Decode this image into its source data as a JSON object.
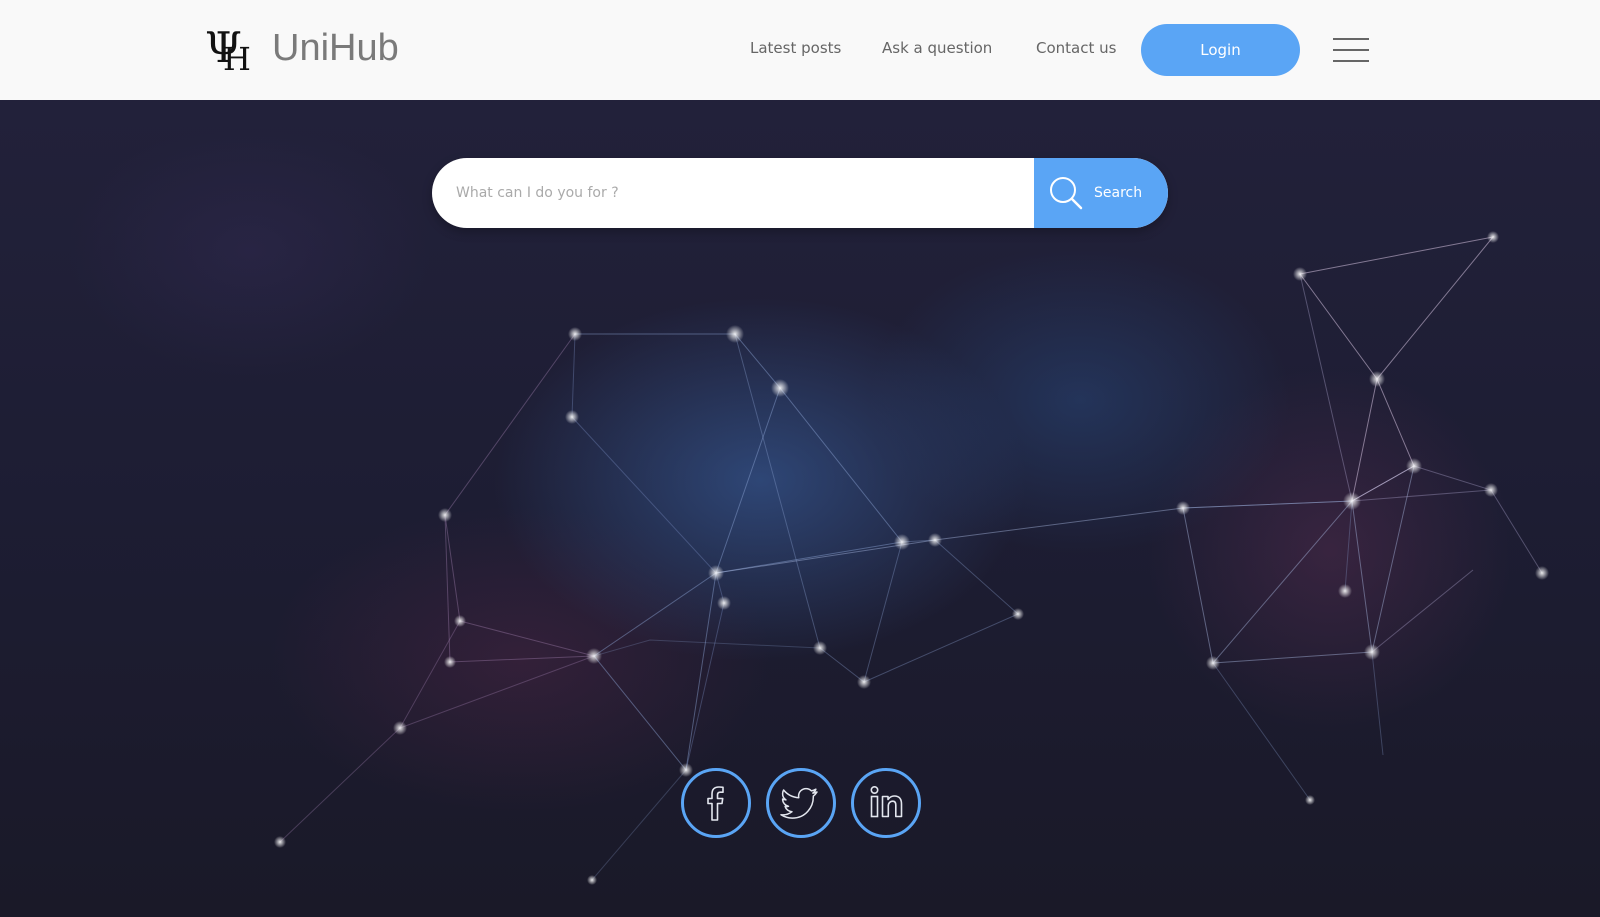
{
  "header": {
    "brand_name": "UniHub",
    "nav": [
      "Latest posts",
      "Ask a question",
      "Contact us"
    ],
    "login_label": "Login"
  },
  "search": {
    "placeholder": "What can I do you for ?",
    "button_label": "Search"
  },
  "social": [
    "facebook-icon",
    "twitter-icon",
    "linkedin-icon"
  ],
  "colors": {
    "accent": "#5aa5f5",
    "header_bg": "#f9f9f9",
    "hero_bg": "#1d1c2a"
  }
}
